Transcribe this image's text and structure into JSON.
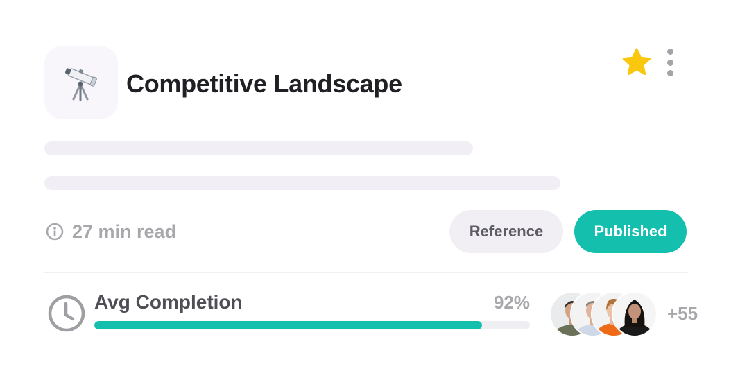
{
  "header": {
    "emoji_icon": "telescope-icon",
    "title": "Competitive Landscape",
    "star_color": "#F9C80E",
    "favorite_icon": "star-icon",
    "menu_icon": "kebab-menu-icon"
  },
  "meta": {
    "info_icon": "info-icon",
    "read_time": "27 min read"
  },
  "tags": {
    "reference_label": "Reference",
    "published_label": "Published",
    "published_color": "#15BFAE"
  },
  "completion": {
    "clock_icon": "clock-icon",
    "label": "Avg Completion",
    "percent_text": "92%",
    "progress_fraction": 0.89,
    "more_count": "+55",
    "avatars": [
      "avatar-1",
      "avatar-2",
      "avatar-3",
      "avatar-4"
    ]
  }
}
